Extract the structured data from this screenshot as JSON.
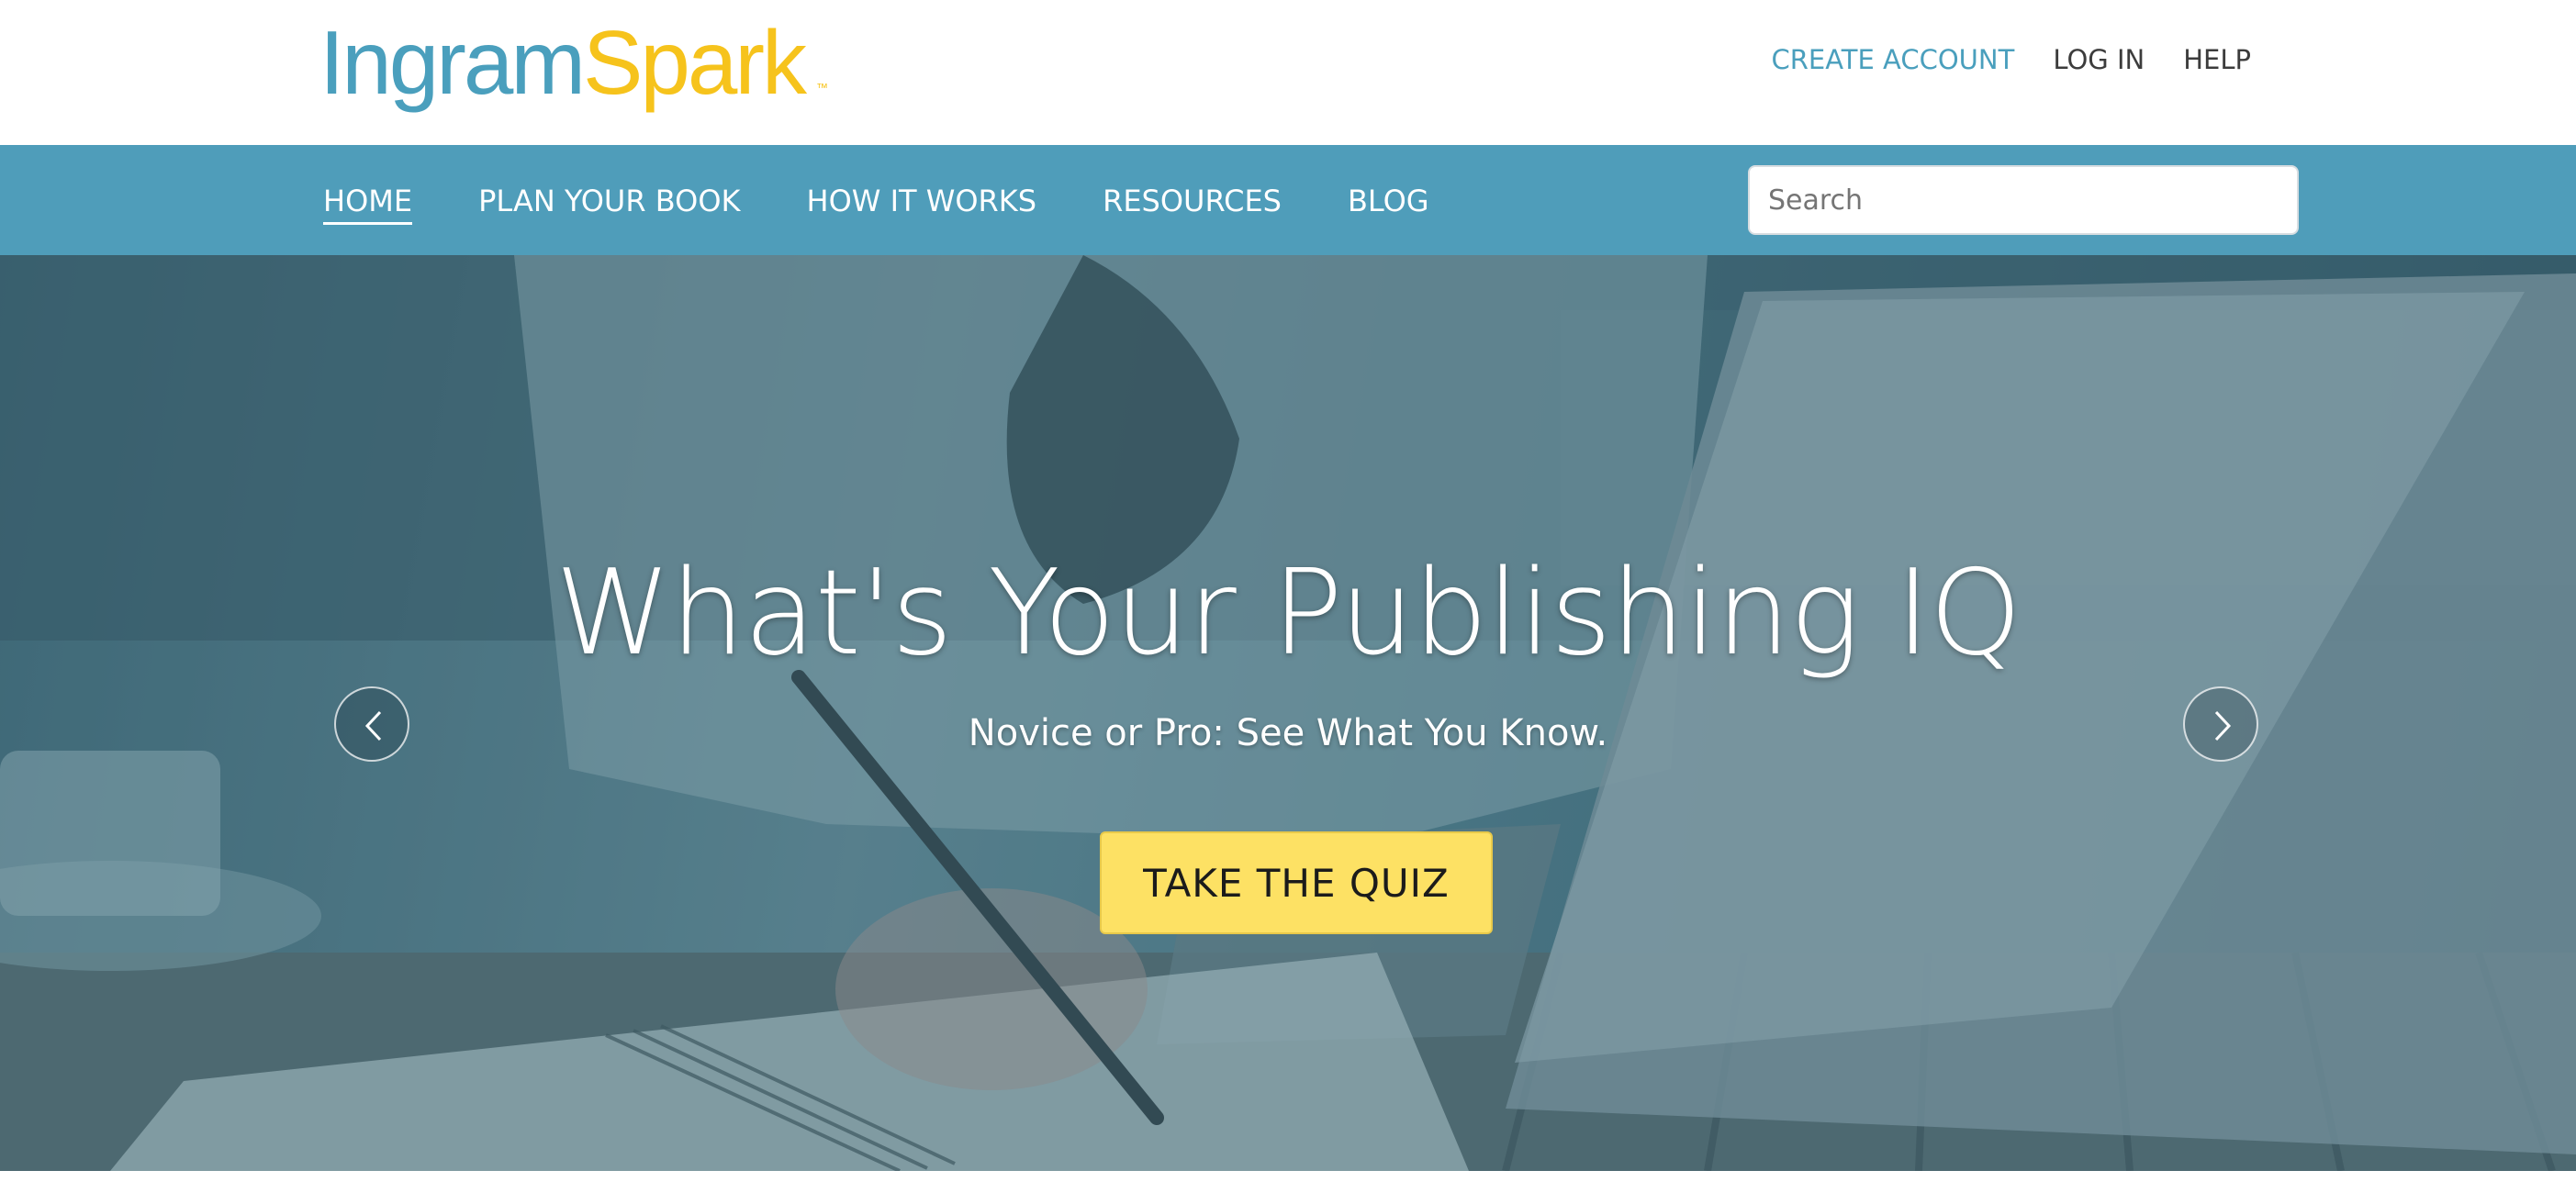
{
  "brand": {
    "logo_part1": "Ingram",
    "logo_part2": "Spark",
    "trademark": "™",
    "colors": {
      "blue": "#4a9fbd",
      "yellow": "#f6c31c"
    }
  },
  "top_links": {
    "create_account": "CREATE ACCOUNT",
    "log_in": "LOG IN",
    "help": "HELP"
  },
  "nav": {
    "items": [
      {
        "label": "HOME",
        "active": true
      },
      {
        "label": "PLAN YOUR BOOK",
        "active": false
      },
      {
        "label": "HOW IT WORKS",
        "active": false
      },
      {
        "label": "RESOURCES",
        "active": false
      },
      {
        "label": "BLOG",
        "active": false
      }
    ],
    "background": "#4f9dba"
  },
  "search": {
    "placeholder": "Search"
  },
  "hero": {
    "title": "What's Your Publishing IQ",
    "subtitle": "Novice or Pro: See What You Know.",
    "cta_label": "TAKE THE QUIZ",
    "cta_color": "#fde164",
    "prev_icon": "chevron-left-icon",
    "next_icon": "chevron-right-icon"
  }
}
